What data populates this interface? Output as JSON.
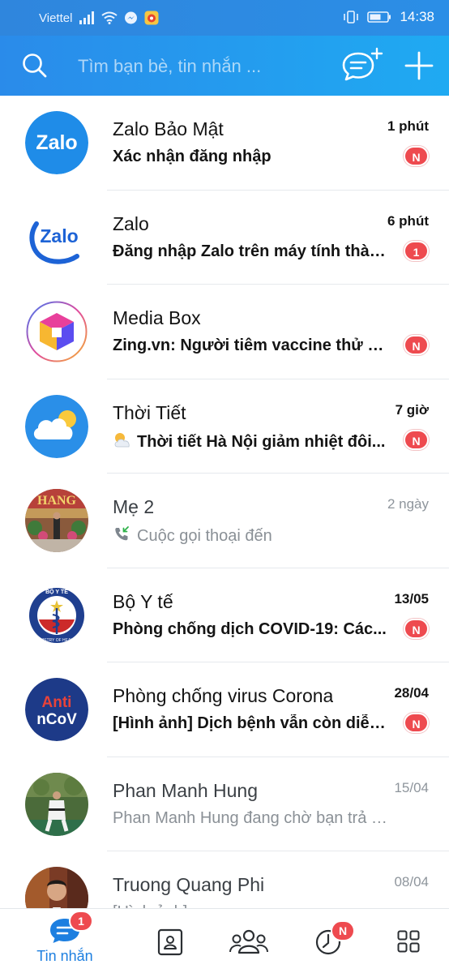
{
  "status_bar": {
    "carrier": "Viettel",
    "time": "14:38"
  },
  "header": {
    "search_placeholder": "Tìm bạn bè, tin nhắn ...",
    "accent_gradient": [
      "#2a8bea",
      "#1faaf2"
    ]
  },
  "conversations": [
    {
      "name": "Zalo Bảo Mật",
      "time": "1 phút",
      "preview": "Xác nhận đăng nhập",
      "badge": "N",
      "unread": true,
      "avatar": "zalo-security-logo"
    },
    {
      "name": "Zalo",
      "time": "6 phút",
      "preview": "Đăng nhập Zalo trên máy tính thàn...",
      "badge": "1",
      "unread": true,
      "avatar": "zalo-logo"
    },
    {
      "name": "Media Box",
      "time": "",
      "preview": "Zing.vn: Người tiêm vaccine thử n...",
      "badge": "N",
      "unread": true,
      "avatar": "media-box-logo"
    },
    {
      "name": "Thời Tiết",
      "time": "7 giờ",
      "preview": "Thời tiết Hà Nội giảm nhiệt đôi...",
      "badge": "N",
      "unread": true,
      "avatar": "weather-logo"
    },
    {
      "name": "Mẹ 2",
      "time": "2 ngày",
      "preview": "Cuộc gọi thoại đến",
      "badge": "",
      "unread": false,
      "avatar": "user-photo"
    },
    {
      "name": "Bộ Y tế",
      "time": "13/05",
      "preview": "Phòng chống dịch COVID-19: Các...",
      "badge": "N",
      "unread": true,
      "avatar": "ministry-of-health-logo"
    },
    {
      "name": "Phòng chống virus Corona",
      "time": "28/04",
      "preview": "[Hình ảnh] Dịch bệnh vẫn còn diễn...",
      "badge": "N",
      "unread": true,
      "avatar": "anti-ncov-logo"
    },
    {
      "name": "Phan Manh Hung",
      "time": "15/04",
      "preview": "Phan Manh Hung đang chờ bạn trả lời...",
      "badge": "",
      "unread": false,
      "avatar": "user-photo"
    },
    {
      "name": "Truong Quang Phi",
      "time": "08/04",
      "preview": "[Hình ảnh]",
      "badge": "",
      "unread": false,
      "avatar": "user-photo"
    }
  ],
  "avatar_text": {
    "zalo_security": "Zalo",
    "zalo": "Zalo",
    "anti_line1": "Anti",
    "anti_line2": "nCoV",
    "moh_top": "BỘ Y TẾ",
    "moh_bottom": "MINISTRY OF HEALTH",
    "me2_banner": "HANG"
  },
  "bottom_nav": {
    "messages_label": "Tin nhắn",
    "messages_badge": "1",
    "timeline_badge": "N"
  }
}
